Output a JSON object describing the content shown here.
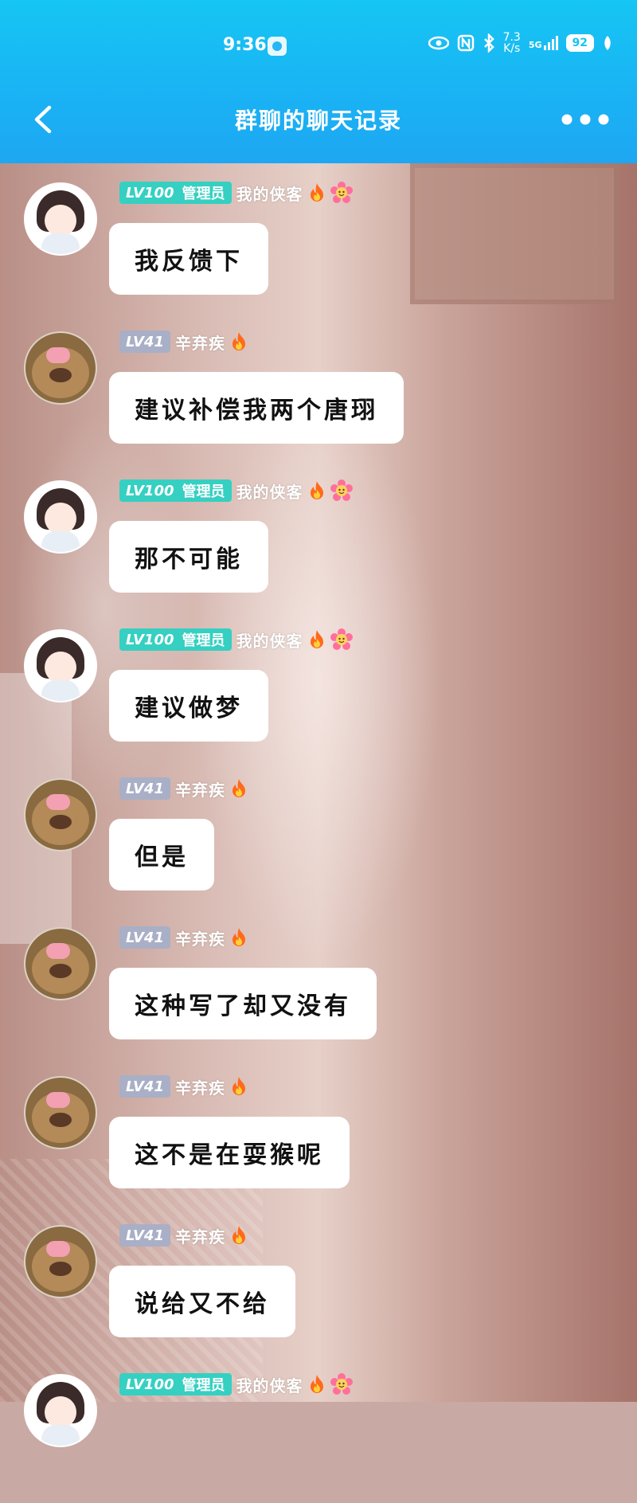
{
  "status_bar": {
    "time": "9:36",
    "network_speed_top": "7.3",
    "network_speed_bottom": "K/s",
    "signal": "5G",
    "battery": "92"
  },
  "header": {
    "title": "群聊的聊天记录"
  },
  "colors": {
    "header_bg": "#1ab2f4",
    "admin_badge": "#35d0c2",
    "level_badge": "#a9afc6",
    "bubble_bg": "#ffffff"
  },
  "messages": [
    {
      "avatar": "girl-avatar",
      "level": "LV100",
      "role": "管理员",
      "name": "我的侠客",
      "icons": [
        "flame-icon",
        "flower-icon"
      ],
      "text": "我反馈下"
    },
    {
      "avatar": "cat-avatar",
      "level": "LV41",
      "role": "",
      "name": "辛弃疾",
      "icons": [
        "flame-icon"
      ],
      "text": "建议补偿我两个唐珝"
    },
    {
      "avatar": "girl-avatar",
      "level": "LV100",
      "role": "管理员",
      "name": "我的侠客",
      "icons": [
        "flame-icon",
        "flower-icon"
      ],
      "text": "那不可能"
    },
    {
      "avatar": "girl-avatar",
      "level": "LV100",
      "role": "管理员",
      "name": "我的侠客",
      "icons": [
        "flame-icon",
        "flower-icon"
      ],
      "text": "建议做梦"
    },
    {
      "avatar": "cat-avatar",
      "level": "LV41",
      "role": "",
      "name": "辛弃疾",
      "icons": [
        "flame-icon"
      ],
      "text": "但是"
    },
    {
      "avatar": "cat-avatar",
      "level": "LV41",
      "role": "",
      "name": "辛弃疾",
      "icons": [
        "flame-icon"
      ],
      "text": "这种写了却又没有"
    },
    {
      "avatar": "cat-avatar",
      "level": "LV41",
      "role": "",
      "name": "辛弃疾",
      "icons": [
        "flame-icon"
      ],
      "text": "这不是在耍猴呢"
    },
    {
      "avatar": "cat-avatar",
      "level": "LV41",
      "role": "",
      "name": "辛弃疾",
      "icons": [
        "flame-icon"
      ],
      "text": "说给又不给"
    },
    {
      "avatar": "girl-avatar",
      "level": "LV100",
      "role": "管理员",
      "name": "我的侠客",
      "icons": [
        "flame-icon",
        "flower-icon"
      ],
      "text": ""
    }
  ]
}
